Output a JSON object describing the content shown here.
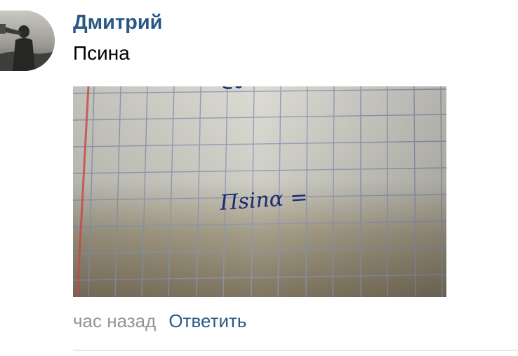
{
  "comment": {
    "author_name": "Дмитрий",
    "text": "Псина",
    "photo": {
      "handwritten_text": "Пsinα ="
    },
    "date": "час назад",
    "reply_label": "Ответить"
  },
  "colors": {
    "link": "#2a5885",
    "meta_gray": "#939393",
    "divider": "#e7e8ec",
    "ink": "#1e2a6e",
    "paper": "#d6d5cd",
    "grid": "#8a9ab5",
    "margin_line": "#e05050"
  }
}
